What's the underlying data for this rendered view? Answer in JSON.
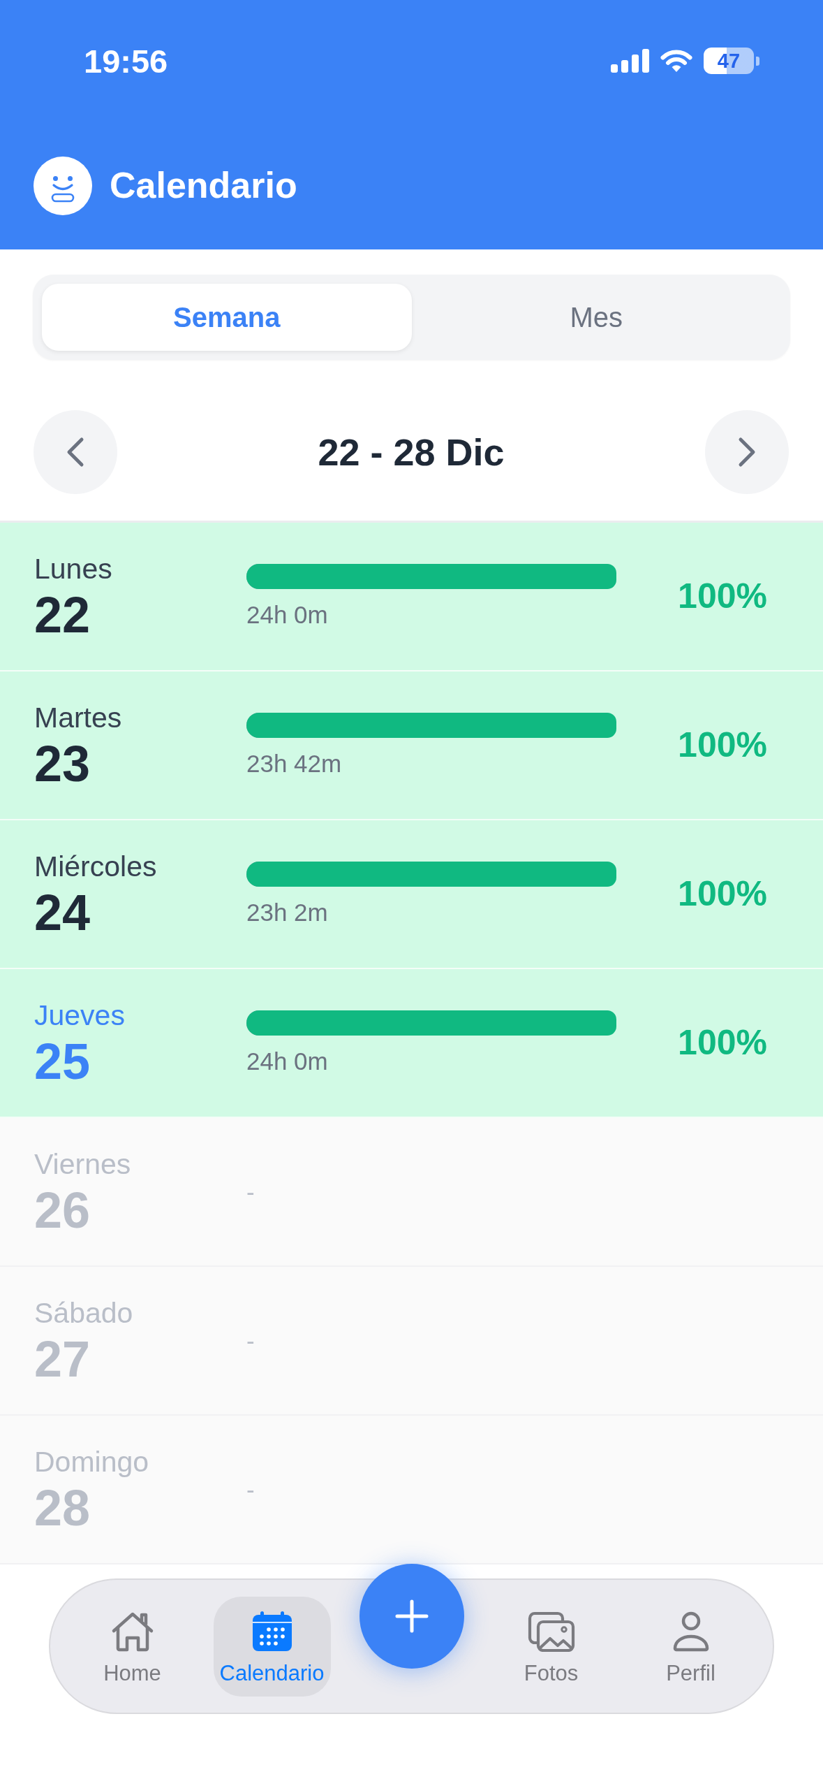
{
  "status_bar": {
    "time": "19:56",
    "battery": "47"
  },
  "header": {
    "title": "Calendario"
  },
  "view_tabs": [
    {
      "label": "Semana",
      "selected": true
    },
    {
      "label": "Mes",
      "selected": false
    }
  ],
  "week_nav": {
    "range": "22 - 28 Dic"
  },
  "days": [
    {
      "kind": "logged",
      "weekday": "Lunes",
      "date": "22",
      "today": false,
      "level": 1,
      "duration": "24h 0m",
      "percent": "100%"
    },
    {
      "kind": "logged",
      "weekday": "Martes",
      "date": "23",
      "today": false,
      "level": 1,
      "duration": "23h 42m",
      "percent": "100%"
    },
    {
      "kind": "logged",
      "weekday": "Miércoles",
      "date": "24",
      "today": false,
      "level": 1,
      "duration": "23h 2m",
      "percent": "100%"
    },
    {
      "kind": "logged",
      "weekday": "Jueves",
      "date": "25",
      "today": true,
      "level": 1,
      "duration": "24h 0m",
      "percent": "100%"
    },
    {
      "kind": "empty",
      "weekday": "Viernes",
      "date": "26",
      "today": false,
      "value": "-"
    },
    {
      "kind": "empty",
      "weekday": "Sábado",
      "date": "27",
      "today": false,
      "value": "-"
    },
    {
      "kind": "empty",
      "weekday": "Domingo",
      "date": "28",
      "today": false,
      "value": "-"
    }
  ],
  "bottom_nav": {
    "items": [
      {
        "kind": "home",
        "label": "Home",
        "selected": false
      },
      {
        "kind": "calendar",
        "label": "Calendario",
        "selected": true
      },
      {
        "kind": "photos",
        "label": "Fotos",
        "selected": false
      },
      {
        "kind": "profile",
        "label": "Perfil",
        "selected": false
      }
    ]
  }
}
